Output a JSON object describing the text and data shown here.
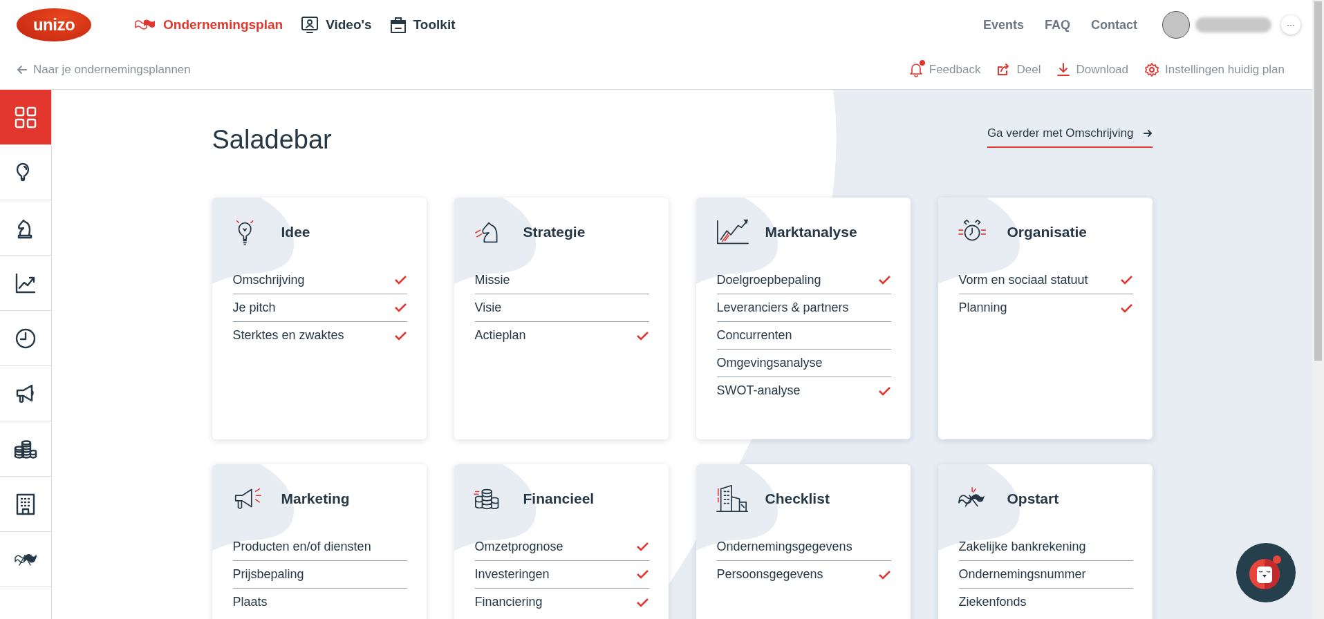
{
  "logo": {
    "text": "unizo"
  },
  "main_nav": [
    {
      "label": "Ondernemingsplan",
      "selected": true
    },
    {
      "label": "Video's",
      "selected": false
    },
    {
      "label": "Toolkit",
      "selected": false
    }
  ],
  "top_links": [
    "Events",
    "FAQ",
    "Contact"
  ],
  "user": {
    "more": "···"
  },
  "back_link": "Naar je ondernemingsplannen",
  "actions": [
    {
      "label": "Feedback",
      "has_notification": true
    },
    {
      "label": "Deel",
      "has_notification": false
    },
    {
      "label": "Download",
      "has_notification": false
    },
    {
      "label": "Instellingen huidig plan",
      "has_notification": false
    }
  ],
  "sidebar": {
    "items": [
      {
        "selected": true
      },
      {
        "selected": false
      },
      {
        "selected": false
      },
      {
        "selected": false
      },
      {
        "selected": false
      },
      {
        "selected": false
      },
      {
        "selected": false
      },
      {
        "selected": false
      },
      {
        "selected": false
      }
    ]
  },
  "page_title": "Saladebar",
  "next_link": "Ga verder met Omschrijving",
  "cards": [
    {
      "title": "Idee",
      "items": [
        {
          "label": "Omschrijving",
          "checked": true
        },
        {
          "label": "Je pitch",
          "checked": true
        },
        {
          "label": "Sterktes en zwaktes",
          "checked": true
        }
      ]
    },
    {
      "title": "Strategie",
      "items": [
        {
          "label": "Missie",
          "checked": false
        },
        {
          "label": "Visie",
          "checked": false
        },
        {
          "label": "Actieplan",
          "checked": true
        }
      ]
    },
    {
      "title": "Marktanalyse",
      "items": [
        {
          "label": "Doelgroepbepaling",
          "checked": true
        },
        {
          "label": "Leveranciers & partners",
          "checked": false
        },
        {
          "label": "Concurrenten",
          "checked": false
        },
        {
          "label": "Omgevingsanalyse",
          "checked": false
        },
        {
          "label": "SWOT-analyse",
          "checked": true
        }
      ]
    },
    {
      "title": "Organisatie",
      "items": [
        {
          "label": "Vorm en sociaal statuut",
          "checked": true
        },
        {
          "label": "Planning",
          "checked": true
        }
      ]
    },
    {
      "title": "Marketing",
      "items": [
        {
          "label": "Producten en/of diensten",
          "checked": false
        },
        {
          "label": "Prijsbepaling",
          "checked": false
        },
        {
          "label": "Plaats",
          "checked": false
        }
      ]
    },
    {
      "title": "Financieel",
      "items": [
        {
          "label": "Omzetprognose",
          "checked": true
        },
        {
          "label": "Investeringen",
          "checked": true
        },
        {
          "label": "Financiering",
          "checked": true
        }
      ]
    },
    {
      "title": "Checklist",
      "items": [
        {
          "label": "Ondernemingsgegevens",
          "checked": false
        },
        {
          "label": "Persoonsgegevens",
          "checked": true
        }
      ]
    },
    {
      "title": "Opstart",
      "items": [
        {
          "label": "Zakelijke bankrekening",
          "checked": false
        },
        {
          "label": "Ondernemingsnummer",
          "checked": false
        },
        {
          "label": "Ziekenfonds",
          "checked": false
        }
      ]
    }
  ]
}
